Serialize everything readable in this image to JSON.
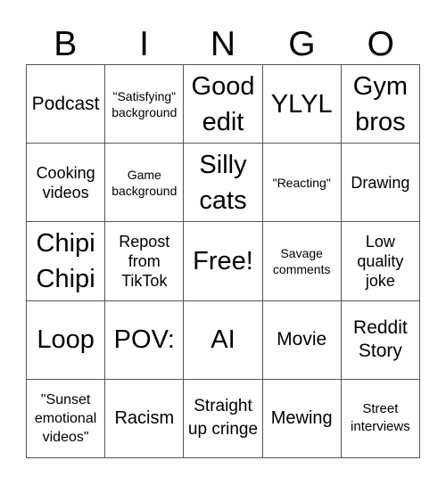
{
  "header": {
    "letters": [
      "B",
      "I",
      "N",
      "G",
      "O"
    ]
  },
  "board": {
    "rows": [
      [
        "Podcast",
        "\"Satisfying\" background",
        "Good edit",
        "YLYL",
        "Gym bros"
      ],
      [
        "Cooking videos",
        "Game background",
        "Silly cats",
        "\"Reacting\"",
        "Drawing"
      ],
      [
        "Chipi Chipi",
        "Repost from TikTok",
        "Free!",
        "Savage comments",
        "Low quality joke"
      ],
      [
        "Loop",
        "POV:",
        "AI",
        "Movie",
        "Reddit Story"
      ],
      [
        "\"Sunset emotional videos\"",
        "Racism",
        "Straight up cringe",
        "Mewing",
        "Street interviews"
      ]
    ],
    "free_space": "Free!"
  }
}
